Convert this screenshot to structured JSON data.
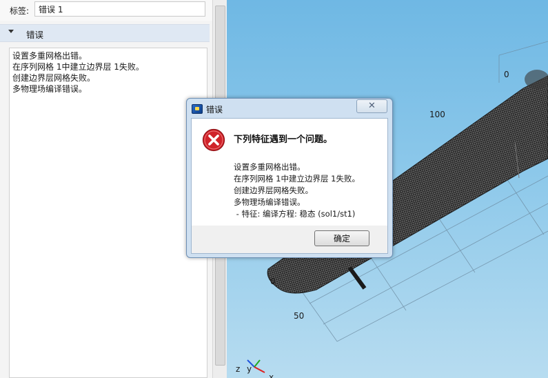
{
  "settings": {
    "label_caption": "标签:",
    "label_value": "错误 1",
    "section_title": "错误",
    "messages": [
      "设置多重网格出错。",
      "在序列网格 1中建立边界层 1失败。",
      "创建边界层网格失败。",
      "多物理场编译错误。"
    ]
  },
  "viewport": {
    "tick_labels": [
      "0",
      "100",
      "0",
      "50"
    ],
    "axis_labels": [
      "z",
      "y",
      "x"
    ]
  },
  "dialog": {
    "title": "错误",
    "close_symbol": "✕",
    "heading": "下列特征遇到一个问题。",
    "details": [
      "设置多重网格出错。",
      "在序列网格 1中建立边界层 1失败。",
      "创建边界层网格失败。",
      "多物理场编译错误。",
      " - 特征: 编译方程: 稳态 (sol1/st1)"
    ],
    "ok_label": "确定"
  },
  "colors": {
    "error_red": "#d0232a",
    "viewport_sky": "#8cc8ea"
  }
}
